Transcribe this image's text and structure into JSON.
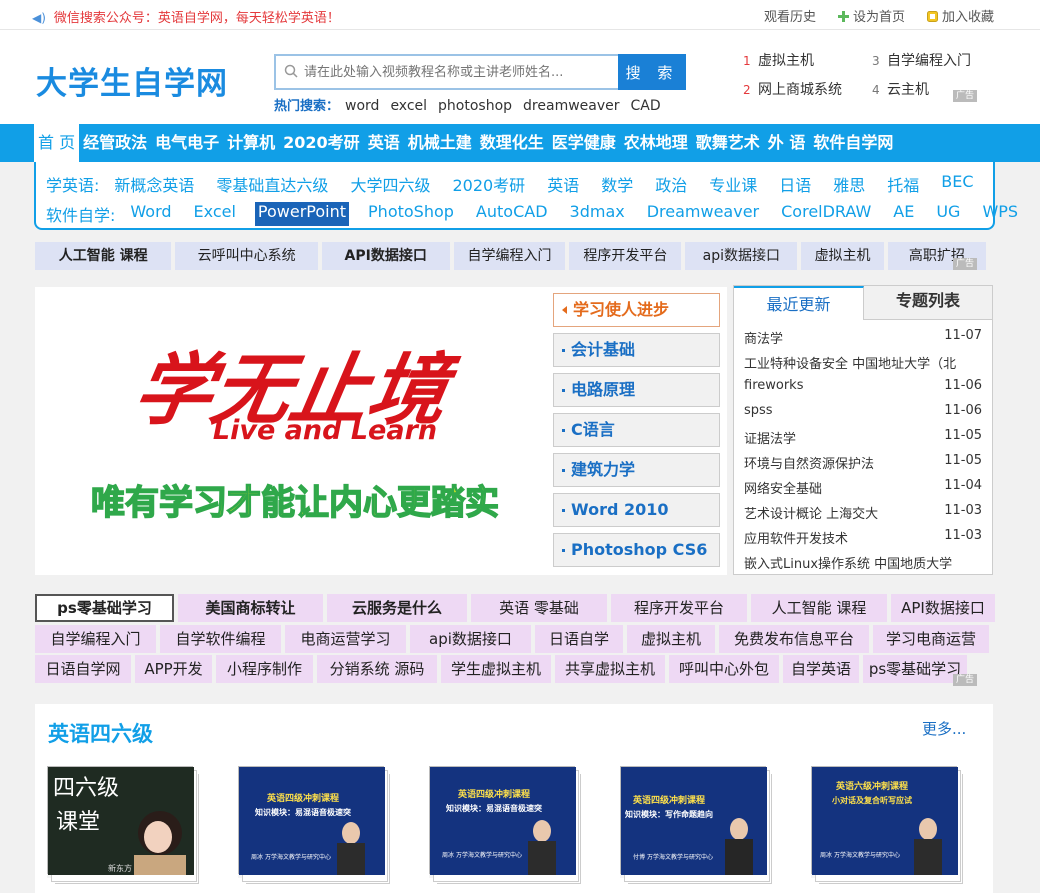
{
  "topbar": {
    "notice": "微信搜索公众号：英语自学网，每天轻松学英语！",
    "links": [
      "观看历史",
      "设为首页",
      "加入收藏"
    ]
  },
  "header": {
    "logo": "大学生自学网",
    "search_placeholder": "请在此处输入视频教程名称或主讲老师姓名...",
    "search_button": "搜 索",
    "hot_label": "热门搜索：",
    "hot_keywords": [
      "word",
      "excel",
      "photoshop",
      "dreamweaver",
      "CAD"
    ],
    "rank": [
      {
        "n": "1",
        "text": "虚拟主机"
      },
      {
        "n": "3",
        "text": "自学编程入门"
      },
      {
        "n": "2",
        "text": "网上商城系统"
      },
      {
        "n": "4",
        "text": "云主机"
      }
    ],
    "ad_tag": "广告"
  },
  "nav": [
    "首 页",
    "经管政法",
    "电气电子",
    "计算机",
    "2020考研",
    "英语",
    "机械土建",
    "数理化生",
    "医学健康",
    "农林地理",
    "歌舞艺术",
    "外 语",
    "软件自学网"
  ],
  "subnav": {
    "row1_label": "学英语:",
    "row1": [
      "新概念英语",
      "零基础直达六级",
      "大学四六级",
      "2020考研",
      "英语",
      "数学",
      "政治",
      "专业课",
      "日语",
      "雅思",
      "托福",
      "BEC"
    ],
    "row2_label": "软件自学:",
    "row2": [
      "Word",
      "Excel",
      "PowerPoint",
      "PhotoShop",
      "AutoCAD",
      "3dmax",
      "Dreamweaver",
      "CorelDRAW",
      "AE",
      "UG",
      "WPS"
    ],
    "row2_selected": "PowerPoint"
  },
  "strip1": [
    "人工智能 课程",
    "云呼叫中心系统",
    "API数据接口",
    "自学编程入门",
    "程序开发平台",
    "api数据接口",
    "虚拟主机",
    "高职扩招"
  ],
  "banner": {
    "title": "学无止境",
    "subtitle": "Live and Learn",
    "slogan": "唯有学习才能让内心更踏实"
  },
  "sidelist": [
    "学习使人进步",
    "会计基础",
    "电路原理",
    "C语言",
    "建筑力学",
    "Word 2010",
    "Photoshop CS6"
  ],
  "updates": {
    "tab_recent": "最近更新",
    "tab_topics": "专题列表",
    "items": [
      {
        "title": "商法学",
        "date": "11-07"
      },
      {
        "title": "工业特种设备安全 中国地址大学（北",
        "date": ""
      },
      {
        "title": "fireworks",
        "date": "11-06"
      },
      {
        "title": "spss",
        "date": "11-06"
      },
      {
        "title": "证据法学",
        "date": "11-05"
      },
      {
        "title": "环境与自然资源保护法",
        "date": "11-05"
      },
      {
        "title": "网络安全基础",
        "date": "11-04"
      },
      {
        "title": "艺术设计概论 上海交大",
        "date": "11-03"
      },
      {
        "title": "应用软件开发技术",
        "date": "11-03"
      },
      {
        "title": "嵌入式Linux操作系统 中国地质大学",
        "date": ""
      }
    ]
  },
  "grid2": {
    "row1": [
      "ps零基础学习",
      "美国商标转让",
      "云服务是什么",
      "英语 零基础",
      "程序开发平台",
      "人工智能 课程",
      "API数据接口"
    ],
    "row2": [
      "自学编程入门",
      "自学软件编程",
      "电商运营学习",
      "api数据接口",
      "日语自学",
      "虚拟主机",
      "免费发布信息平台",
      "学习电商运营"
    ],
    "row3": [
      "日语自学网",
      "APP开发",
      "小程序制作",
      "分销系统 源码",
      "学生虚拟主机",
      "共享虚拟主机",
      "呼叫中心外包",
      "自学英语",
      "ps零基础学习"
    ]
  },
  "section": {
    "title": "英语四六级",
    "more": "更多...",
    "thumbs": [
      {
        "line1": "四六级",
        "line2": "课堂",
        "caption": "新东方"
      },
      {
        "line1": "英语四级冲刺课程",
        "line2": "知识模块：易混语音极速突",
        "caption": "周冰 万学海文教学与研究中心"
      },
      {
        "line1": "英语四级冲刺课程",
        "line2": "知识模块：易混语音极速突",
        "caption": "周冰 万学海文教学与研究中心"
      },
      {
        "line1": "英语四级冲刺课程",
        "line2": "知识模块：写作命题趋向",
        "caption": "付博 万学海文教学与研究中心"
      },
      {
        "line1": "英语六级冲刺课程",
        "line2": "小对话及复合听写应试",
        "caption": "周冰 万学海文教学与研究中心"
      }
    ]
  },
  "colors": {
    "brand_blue": "#119fe7",
    "accent_red": "#e4393c",
    "strip_blue": "#dde2f4",
    "strip_purple": "#eed9f4"
  }
}
